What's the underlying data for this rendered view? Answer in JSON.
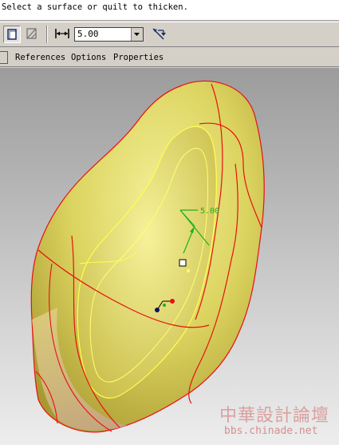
{
  "message": "Select a surface or quilt to thicken.",
  "toolbar": {
    "thickness_value": "5.00",
    "icons": [
      "surface-thicken-icon",
      "remove-material-icon",
      "thickness-dimension-icon",
      "flip-direction-icon"
    ]
  },
  "tabs": [
    "References",
    "Options",
    "Properties"
  ],
  "model": {
    "dimension_label": "5.00",
    "colors": {
      "surface": "#e8e070",
      "edges": "#e81010",
      "highlight": "#ffff60",
      "dimension": "#20b020"
    }
  },
  "watermark": {
    "title": "中華設計論壇",
    "url": "bbs.chinade.net"
  }
}
